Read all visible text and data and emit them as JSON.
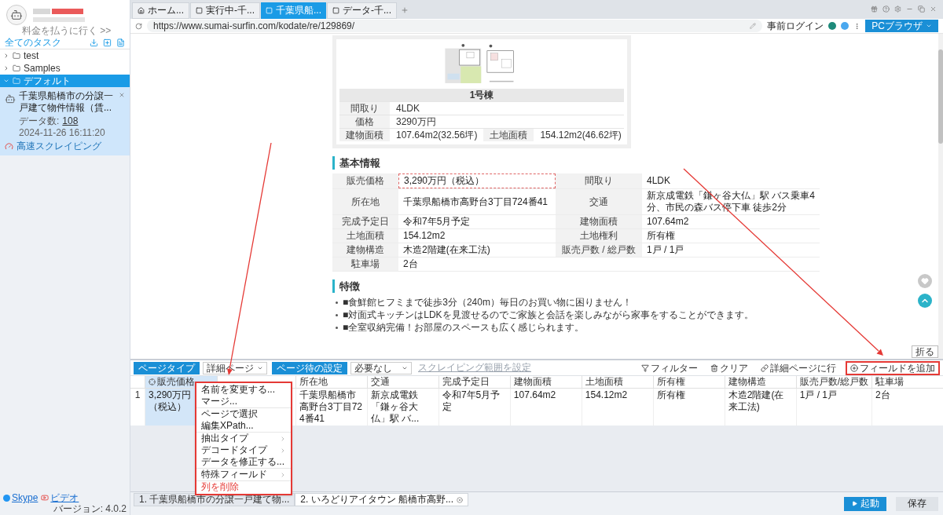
{
  "sidebar": {
    "pay_link": "料金を払うに行く >>",
    "all_tasks": "全てのタスク",
    "tree": [
      {
        "label": "test",
        "expanded": false,
        "selected": false
      },
      {
        "label": "Samples",
        "expanded": false,
        "selected": false
      },
      {
        "label": "デフォルト",
        "expanded": true,
        "selected": true,
        "children": [
          {
            "title": "千葉県船橋市の分譲一戸建て物件情報（賃...",
            "count_label": "データ数:",
            "count": "108",
            "time": "2024-11-26 16:11:20",
            "mode": "高速スクレイピング"
          }
        ]
      }
    ],
    "footer": {
      "links": [
        {
          "label": "Skype",
          "kind": "skype"
        },
        {
          "label": "ビデオ",
          "kind": "video"
        }
      ],
      "version": "バージョン: 4.0.2"
    }
  },
  "browser": {
    "tabs": [
      {
        "label": "ホーム...",
        "kind": "home",
        "selected": false
      },
      {
        "label": "実行中-千...",
        "kind": "page",
        "selected": false
      },
      {
        "label": "千葉県船...",
        "kind": "page",
        "selected": true
      },
      {
        "label": "データ-千...",
        "kind": "page",
        "selected": false
      }
    ],
    "url": "https://www.sumai-surfin.com/kodate/re/129869/",
    "login": "事前ログイン",
    "mode_button": "PCブラウザ"
  },
  "page": {
    "floorplan": {
      "kind": "picture",
      "title": "1号棟",
      "rows": [
        [
          {
            "label": "間取り",
            "value": "4LDK"
          }
        ],
        [
          {
            "label": "価格",
            "value": "3290万円"
          }
        ],
        [
          {
            "label": "建物面積",
            "value": "107.64m2(32.56坪)"
          },
          {
            "label": "土地面積",
            "value": "154.12m2(46.62坪)"
          }
        ]
      ]
    },
    "basic": {
      "heading": "基本情報",
      "rows": [
        [
          {
            "label": "販売価格",
            "value": "3,290万円（税込）",
            "highlighted": true
          },
          {
            "label": "間取り",
            "value": "4LDK",
            "highlighted": false
          }
        ],
        [
          {
            "label": "所在地",
            "value": "千葉県船橋市高野台3丁目724番41",
            "highlighted": false
          },
          {
            "label": "交通",
            "value": "新京成電鉄「鎌ヶ谷大仏」駅 バス乗車4分、市民の森バス停下車 徒歩2分",
            "highlighted": false
          }
        ],
        [
          {
            "label": "完成予定日",
            "value": "令和7年5月予定",
            "highlighted": false
          },
          {
            "label": "建物面積",
            "value": "107.64m2",
            "highlighted": false
          }
        ],
        [
          {
            "label": "土地面積",
            "value": "154.12m2",
            "highlighted": false
          },
          {
            "label": "土地権利",
            "value": "所有権",
            "highlighted": false
          }
        ],
        [
          {
            "label": "建物構造",
            "value": "木造2階建(在来工法)",
            "highlighted": false
          },
          {
            "label": "販売戸数 / 総戸数",
            "value": "1戸 / 1戸",
            "highlighted": false
          }
        ],
        [
          {
            "label": "駐車場",
            "value": "2台",
            "highlighted": false
          }
        ]
      ]
    },
    "features": {
      "heading": "特徴",
      "items": [
        "■食鮮館ヒフミまで徒歩3分（240m）毎日のお買い物に困りません！",
        "■対面式キッチンはLDKを見渡せるのでご家族と会話を楽しみながら家事をすることができます。",
        "■全室収納完備！お部屋のスペースも広く感じられます。"
      ]
    },
    "collapse": "折る"
  },
  "extractor": {
    "page_type": {
      "label": "ページタイプ",
      "value": "詳細ページ"
    },
    "wait": {
      "label": "ページ待の設定",
      "value": "必要なし"
    },
    "scope": {
      "label": "スクレイピング範囲を設定",
      "disabled": true
    },
    "tools": [
      {
        "label": "フィルター",
        "kind": "filter",
        "annotated": false
      },
      {
        "label": "クリア",
        "kind": "clear",
        "annotated": false
      },
      {
        "label": "詳細ページに行",
        "kind": "link",
        "annotated": false
      },
      {
        "label": "フィールドを追加",
        "kind": "add",
        "annotated": true
      }
    ],
    "columns": [
      {
        "label": "販売価格",
        "selected": true
      },
      {
        "selected": false
      },
      {
        "label": "所在地",
        "selected": false
      },
      {
        "label": "交通",
        "selected": false
      },
      {
        "label": "完成予定日",
        "selected": false
      },
      {
        "label": "建物面積",
        "selected": false
      },
      {
        "label": "土地面積",
        "selected": false
      },
      {
        "label": "所有権",
        "selected": false
      },
      {
        "label": "建物構造",
        "selected": false
      },
      {
        "label": "販売戸数/総戸数",
        "selected": false
      },
      {
        "label": "駐車場",
        "selected": false
      }
    ],
    "rows": [
      {
        "index": "1",
        "cells": [
          "3,290万円（税込）",
          null,
          "千葉県船橋市高野台3丁目724番41",
          "新京成電鉄「鎌ヶ谷大仏」駅 バ...",
          "令和7年5月予定",
          "107.64m2",
          "154.12m2",
          "所有権",
          "木造2階建(在来工法)",
          "1戸 / 1戸",
          "2台"
        ]
      }
    ]
  },
  "context_menu": {
    "annotated": true,
    "groups": [
      [
        {
          "label": "名前を変更する...",
          "kind": "action"
        },
        {
          "label": "マージ...",
          "kind": "action"
        }
      ],
      [
        {
          "label": "ページで選択",
          "kind": "action"
        },
        {
          "label": "編集XPath...",
          "kind": "action"
        }
      ],
      [
        {
          "label": "抽出タイプ",
          "kind": "submenu"
        },
        {
          "label": "デコードタイプ",
          "kind": "submenu"
        },
        {
          "label": "データを修正する...",
          "kind": "action"
        }
      ],
      [
        {
          "label": "特殊フィールド",
          "kind": "submenu"
        }
      ],
      [
        {
          "label": "列を削除",
          "kind": "danger"
        }
      ]
    ]
  },
  "task_tabs": [
    {
      "label": "1. 千葉県船橋市の分譲一戸建て物...",
      "selected": false
    },
    {
      "label": "2. いろどりアイタウン 船橋市高野...",
      "selected": true
    }
  ],
  "actions": [
    {
      "label": "起動",
      "kind": "primary"
    },
    {
      "label": "保存",
      "kind": "secondary"
    }
  ]
}
